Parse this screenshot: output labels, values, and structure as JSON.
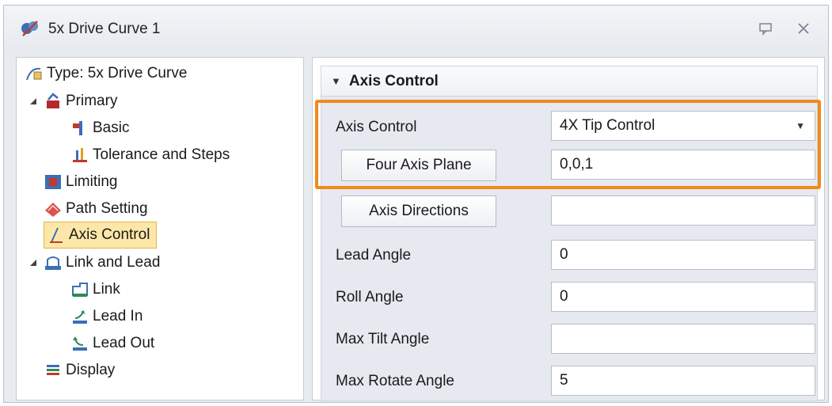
{
  "window": {
    "title": "5x Drive Curve 1"
  },
  "tree": {
    "items": [
      {
        "label": "Type: 5x Drive Curve"
      },
      {
        "label": "Primary"
      },
      {
        "label": "Basic"
      },
      {
        "label": "Tolerance and Steps"
      },
      {
        "label": "Limiting"
      },
      {
        "label": "Path Setting"
      },
      {
        "label": "Axis Control"
      },
      {
        "label": "Link and Lead"
      },
      {
        "label": "Link"
      },
      {
        "label": "Lead In"
      },
      {
        "label": "Lead Out"
      },
      {
        "label": "Display"
      }
    ],
    "selected": "Axis Control"
  },
  "section": {
    "title": "Axis Control"
  },
  "fields": {
    "axis_control": {
      "label": "Axis Control",
      "value": "4X Tip Control"
    },
    "four_axis_plane": {
      "label": "Four Axis Plane",
      "value": "0,0,1"
    },
    "axis_directions": {
      "label": "Axis Directions",
      "value": ""
    },
    "lead_angle": {
      "label": "Lead Angle",
      "value": "0"
    },
    "roll_angle": {
      "label": "Roll Angle",
      "value": "0"
    },
    "max_tilt_angle": {
      "label": "Max Tilt Angle",
      "value": ""
    },
    "max_rotate_angle": {
      "label": "Max Rotate Angle",
      "value": "5"
    }
  },
  "colors": {
    "highlight": "#f08a1c",
    "selection": "#fde7a8"
  }
}
